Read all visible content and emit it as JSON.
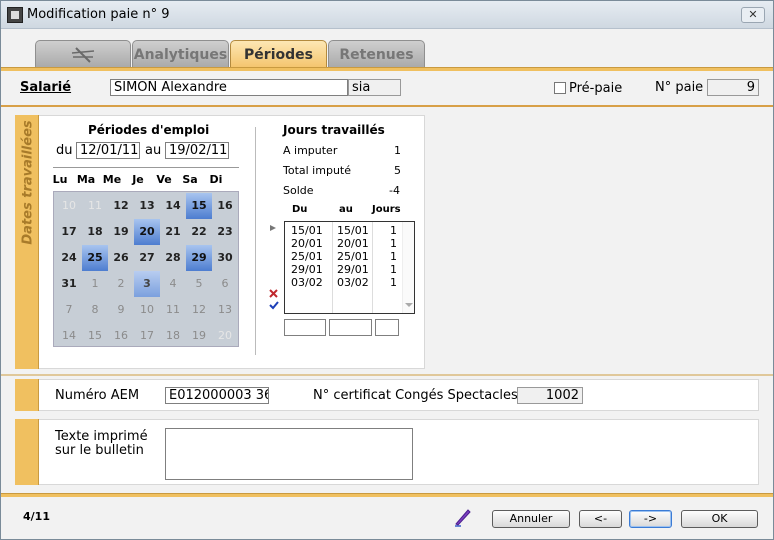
{
  "window": {
    "title": "Modification paie n° 9",
    "close": "✕"
  },
  "tabs": [
    {
      "label": ""
    },
    {
      "label": "Analytiques"
    },
    {
      "label": "Périodes"
    },
    {
      "label": "Retenues"
    }
  ],
  "header": {
    "salarie_label": "Salarié",
    "salarie_name": "SIMON Alexandre",
    "salarie_code": "sia",
    "prepaie_label": "Pré-paie",
    "npaie_label": "N° paie",
    "npaie_value": "9"
  },
  "dates": {
    "side_label": "Dates travaillées",
    "periods_title": "Périodes d'emploi",
    "du": "du",
    "du_value": "12/01/11",
    "au": "au",
    "au_value": "19/02/11",
    "day_headers": [
      "Lu",
      "Ma",
      "Me",
      "Je",
      "Ve",
      "Sa",
      "Di"
    ],
    "calendar": [
      [
        "10",
        "11",
        "12",
        "13",
        "14",
        "15",
        "16"
      ],
      [
        "17",
        "18",
        "19",
        "20",
        "21",
        "22",
        "23"
      ],
      [
        "24",
        "25",
        "26",
        "27",
        "28",
        "29",
        "30"
      ],
      [
        "31",
        "1",
        "2",
        "3",
        "4",
        "5",
        "6"
      ],
      [
        "7",
        "8",
        "9",
        "10",
        "11",
        "12",
        "13"
      ],
      [
        "14",
        "15",
        "16",
        "17",
        "18",
        "19",
        "20"
      ]
    ],
    "jours_title": "Jours travaillés",
    "a_imputer_label": "A imputer",
    "a_imputer_value": "1",
    "total_label": "Total imputé",
    "total_value": "5",
    "solde_label": "Solde",
    "solde_value": "-4",
    "list_headers": [
      "Du",
      "au",
      "Jours"
    ],
    "list_rows": [
      [
        "15/01",
        "15/01",
        "1"
      ],
      [
        "20/01",
        "20/01",
        "1"
      ],
      [
        "25/01",
        "25/01",
        "1"
      ],
      [
        "29/01",
        "29/01",
        "1"
      ],
      [
        "03/02",
        "03/02",
        "1"
      ]
    ]
  },
  "aem": {
    "label": "Numéro AEM",
    "value": "E012000003 36",
    "cert_label": "N° certificat Congés Spectacles",
    "cert_value": "1002"
  },
  "texte": {
    "label_line1": "Texte imprimé",
    "label_line2": "sur le bulletin",
    "value": ""
  },
  "footer": {
    "counter": "4/11",
    "annuler": "Annuler",
    "prev": "<-",
    "next": "->",
    "ok": "OK"
  },
  "colors": {
    "accent": "#f0c060",
    "selected_day": "#4d7dd0"
  }
}
